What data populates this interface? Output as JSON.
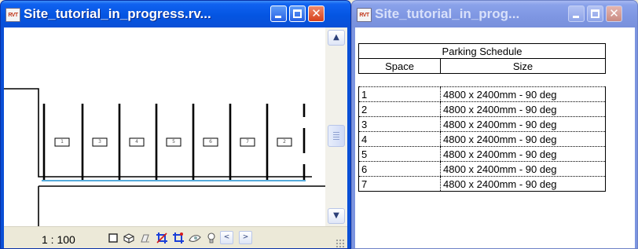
{
  "windows": [
    {
      "title": "Site_tutorial_in_progress.rv...",
      "app_icon_text": "RVT",
      "active": true,
      "view": {
        "scale": "1 : 100",
        "parking_labels": [
          "1",
          "3",
          "4",
          "5",
          "6",
          "7",
          "2"
        ],
        "view_controls": [
          "crop-region-icon",
          "model-graphics-icon",
          "shadows-icon",
          "crop-view-icon",
          "reveal-hidden-icon",
          "temporary-hide-icon",
          "lightbulb-icon"
        ],
        "scroll_left_symbol": "<",
        "scroll_right_symbol": ">",
        "scroll_up_symbol": "▲",
        "scroll_down_symbol": "▼"
      }
    },
    {
      "title": "Site_tutorial_in_prog...",
      "app_icon_text": "RVT",
      "active": false,
      "schedule": {
        "title": "Parking Schedule",
        "columns": [
          "Space",
          "Size"
        ],
        "rows": [
          {
            "space": "1",
            "size": "4800 x 2400mm - 90 deg"
          },
          {
            "space": "2",
            "size": "4800 x 2400mm - 90 deg"
          },
          {
            "space": "3",
            "size": "4800 x 2400mm - 90 deg"
          },
          {
            "space": "4",
            "size": "4800 x 2400mm - 90 deg"
          },
          {
            "space": "5",
            "size": "4800 x 2400mm - 90 deg"
          },
          {
            "space": "6",
            "size": "4800 x 2400mm - 90 deg"
          },
          {
            "space": "7",
            "size": "4800 x 2400mm - 90 deg"
          }
        ]
      }
    }
  ],
  "title_buttons": {
    "minimize": "_",
    "maximize": "□",
    "close": "✕"
  },
  "colors": {
    "active_title": "#0a4fd6",
    "inactive_title": "#7c94e0",
    "close_button": "#d6401c",
    "floor_line": "#1e8fd0"
  }
}
